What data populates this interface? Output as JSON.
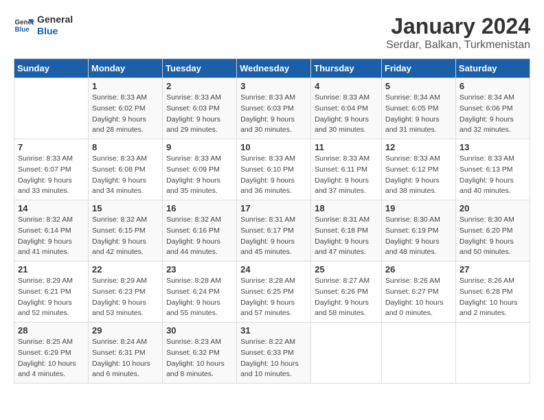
{
  "logo": {
    "text_general": "General",
    "text_blue": "Blue"
  },
  "title": "January 2024",
  "subtitle": "Serdar, Balkan, Turkmenistan",
  "days_of_week": [
    "Sunday",
    "Monday",
    "Tuesday",
    "Wednesday",
    "Thursday",
    "Friday",
    "Saturday"
  ],
  "weeks": [
    [
      {
        "day": "",
        "info": ""
      },
      {
        "day": "1",
        "info": "Sunrise: 8:33 AM\nSunset: 6:02 PM\nDaylight: 9 hours\nand 28 minutes."
      },
      {
        "day": "2",
        "info": "Sunrise: 8:33 AM\nSunset: 6:03 PM\nDaylight: 9 hours\nand 29 minutes."
      },
      {
        "day": "3",
        "info": "Sunrise: 8:33 AM\nSunset: 6:03 PM\nDaylight: 9 hours\nand 30 minutes."
      },
      {
        "day": "4",
        "info": "Sunrise: 8:33 AM\nSunset: 6:04 PM\nDaylight: 9 hours\nand 30 minutes."
      },
      {
        "day": "5",
        "info": "Sunrise: 8:34 AM\nSunset: 6:05 PM\nDaylight: 9 hours\nand 31 minutes."
      },
      {
        "day": "6",
        "info": "Sunrise: 8:34 AM\nSunset: 6:06 PM\nDaylight: 9 hours\nand 32 minutes."
      }
    ],
    [
      {
        "day": "7",
        "info": "Sunrise: 8:33 AM\nSunset: 6:07 PM\nDaylight: 9 hours\nand 33 minutes."
      },
      {
        "day": "8",
        "info": "Sunrise: 8:33 AM\nSunset: 6:08 PM\nDaylight: 9 hours\nand 34 minutes."
      },
      {
        "day": "9",
        "info": "Sunrise: 8:33 AM\nSunset: 6:09 PM\nDaylight: 9 hours\nand 35 minutes."
      },
      {
        "day": "10",
        "info": "Sunrise: 8:33 AM\nSunset: 6:10 PM\nDaylight: 9 hours\nand 36 minutes."
      },
      {
        "day": "11",
        "info": "Sunrise: 8:33 AM\nSunset: 6:11 PM\nDaylight: 9 hours\nand 37 minutes."
      },
      {
        "day": "12",
        "info": "Sunrise: 8:33 AM\nSunset: 6:12 PM\nDaylight: 9 hours\nand 38 minutes."
      },
      {
        "day": "13",
        "info": "Sunrise: 8:33 AM\nSunset: 6:13 PM\nDaylight: 9 hours\nand 40 minutes."
      }
    ],
    [
      {
        "day": "14",
        "info": "Sunrise: 8:32 AM\nSunset: 6:14 PM\nDaylight: 9 hours\nand 41 minutes."
      },
      {
        "day": "15",
        "info": "Sunrise: 8:32 AM\nSunset: 6:15 PM\nDaylight: 9 hours\nand 42 minutes."
      },
      {
        "day": "16",
        "info": "Sunrise: 8:32 AM\nSunset: 6:16 PM\nDaylight: 9 hours\nand 44 minutes."
      },
      {
        "day": "17",
        "info": "Sunrise: 8:31 AM\nSunset: 6:17 PM\nDaylight: 9 hours\nand 45 minutes."
      },
      {
        "day": "18",
        "info": "Sunrise: 8:31 AM\nSunset: 6:18 PM\nDaylight: 9 hours\nand 47 minutes."
      },
      {
        "day": "19",
        "info": "Sunrise: 8:30 AM\nSunset: 6:19 PM\nDaylight: 9 hours\nand 48 minutes."
      },
      {
        "day": "20",
        "info": "Sunrise: 8:30 AM\nSunset: 6:20 PM\nDaylight: 9 hours\nand 50 minutes."
      }
    ],
    [
      {
        "day": "21",
        "info": "Sunrise: 8:29 AM\nSunset: 6:21 PM\nDaylight: 9 hours\nand 52 minutes."
      },
      {
        "day": "22",
        "info": "Sunrise: 8:29 AM\nSunset: 6:23 PM\nDaylight: 9 hours\nand 53 minutes."
      },
      {
        "day": "23",
        "info": "Sunrise: 8:28 AM\nSunset: 6:24 PM\nDaylight: 9 hours\nand 55 minutes."
      },
      {
        "day": "24",
        "info": "Sunrise: 8:28 AM\nSunset: 6:25 PM\nDaylight: 9 hours\nand 57 minutes."
      },
      {
        "day": "25",
        "info": "Sunrise: 8:27 AM\nSunset: 6:26 PM\nDaylight: 9 hours\nand 58 minutes."
      },
      {
        "day": "26",
        "info": "Sunrise: 8:26 AM\nSunset: 6:27 PM\nDaylight: 10 hours\nand 0 minutes."
      },
      {
        "day": "27",
        "info": "Sunrise: 8:26 AM\nSunset: 6:28 PM\nDaylight: 10 hours\nand 2 minutes."
      }
    ],
    [
      {
        "day": "28",
        "info": "Sunrise: 8:25 AM\nSunset: 6:29 PM\nDaylight: 10 hours\nand 4 minutes."
      },
      {
        "day": "29",
        "info": "Sunrise: 8:24 AM\nSunset: 6:31 PM\nDaylight: 10 hours\nand 6 minutes."
      },
      {
        "day": "30",
        "info": "Sunrise: 8:23 AM\nSunset: 6:32 PM\nDaylight: 10 hours\nand 8 minutes."
      },
      {
        "day": "31",
        "info": "Sunrise: 8:22 AM\nSunset: 6:33 PM\nDaylight: 10 hours\nand 10 minutes."
      },
      {
        "day": "",
        "info": ""
      },
      {
        "day": "",
        "info": ""
      },
      {
        "day": "",
        "info": ""
      }
    ]
  ]
}
